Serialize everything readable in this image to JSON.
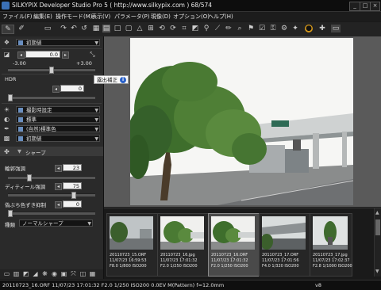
{
  "window": {
    "title": "SILKYPIX Developer Studio Pro 5 ( http://www.silkypix.com )   68/574",
    "min": "_",
    "max": "□",
    "close": "×"
  },
  "menu": [
    "ファイル(F)",
    "編集(E)",
    "操作モード(M)",
    "表示(V)",
    "パラメータ(P)",
    "現像(D)",
    "オプション(O)",
    "ヘルプ(H)"
  ],
  "left_panel": {
    "wb_preset": "初期値",
    "exposure_value": "0.0",
    "exposure_min": "-3.00",
    "exposure_max": "+3.00",
    "hdr_label": "HDR",
    "hdr_value": "0",
    "tone_preset": "撮影時設定",
    "contrast_preset": "標準",
    "color_preset": "(自然)標準色",
    "noise_preset": "初期値",
    "sharp_section": "シャープ",
    "outline_label": "輪郭強調",
    "outline_value": "23",
    "detail_label": "ディティール強調",
    "detail_value": "75",
    "false_label": "偽ぶち色ずき抑制",
    "false_value": "0",
    "type_label": "種類",
    "type_value": "ノーマルシャープ"
  },
  "tooltip": {
    "text": "露出補正",
    "info": "i"
  },
  "thumbnails": [
    {
      "file": "20110723_15.ORF",
      "date": "11/07/23 16:59:53",
      "exif": "F8.0 1/800 ISO200"
    },
    {
      "file": "20110723_16.jpg",
      "date": "11/07/23 17:01:32",
      "exif": "F2.0 1/250 ISO200"
    },
    {
      "file": "20110723_16.ORF",
      "date": "11/07/23 17:01:32",
      "exif": "F2.0 1/250 ISO200"
    },
    {
      "file": "20110723_17.ORF",
      "date": "11/07/23 17:01:56",
      "exif": "F4.0 1/320 ISO200"
    },
    {
      "file": "20110723_17.jpg",
      "date": "11/07/23 17:02:37",
      "exif": "F2.8 1/1000 ISO200"
    }
  ],
  "status": {
    "text": "20110723_16.ORF 11/07/23 17:01:32 F2.0 1/250 ISO200  0.0EV M(Pattern) f=12.0mm",
    "mode": "v8"
  }
}
